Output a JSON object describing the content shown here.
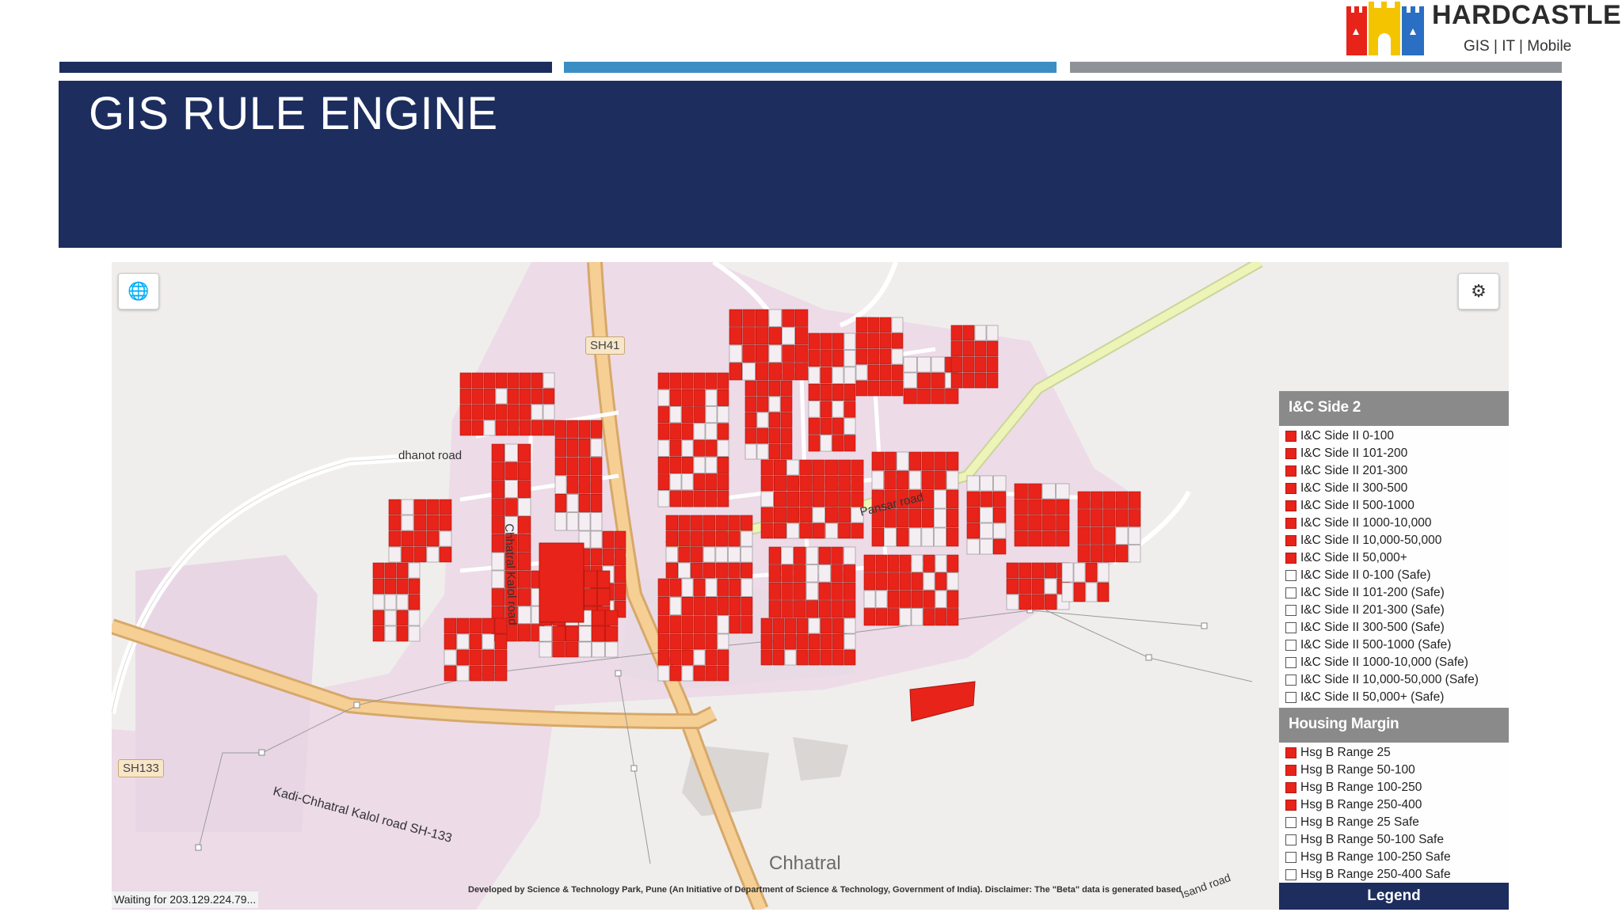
{
  "logo": {
    "title": "HARDCASTLE",
    "subtitle": "GIS | IT | Mobile",
    "colors": [
      "#e8231a",
      "#f5c400",
      "#2a6fc4"
    ]
  },
  "bars": {
    "colors": [
      "#1c2d5e",
      "#3b8ec4",
      "#8f9398"
    ]
  },
  "title_block": {
    "title": "GIS RULE ENGINE",
    "background": "#1c2d5e"
  },
  "map": {
    "controls": {
      "globe_icon": "globe-icon",
      "settings_icon": "gear-icon"
    },
    "labels": {
      "road_dhanot": "dhanot road",
      "road_pansar": "Pansar road",
      "road_chhatral": "Chhatral Kalol road",
      "road_kadi": "Kadi-Chhatral Kalol road SH-133",
      "road_isand": "Isand road",
      "shield_sh41": "SH41",
      "shield_sh133": "SH133",
      "town": "Chhatral"
    },
    "attribution": "Developed by Science & Technology Park, Pune (An Initiative of Department of Science & Technology, Government of India). Disclaimer: The \"Beta\" data is generated based",
    "status": "Waiting for 203.129.224.79...",
    "parcel_color": "#e8231a"
  },
  "legend": {
    "section1": {
      "title": "I&C Side 2",
      "items": [
        {
          "label": "I&C Side II 0-100",
          "checked": true
        },
        {
          "label": "I&C Side II 101-200",
          "checked": true
        },
        {
          "label": "I&C Side II 201-300",
          "checked": true
        },
        {
          "label": "I&C Side II 300-500",
          "checked": true
        },
        {
          "label": "I&C Side II 500-1000",
          "checked": true
        },
        {
          "label": "I&C Side II 1000-10,000",
          "checked": true
        },
        {
          "label": "I&C Side II 10,000-50,000",
          "checked": true
        },
        {
          "label": "I&C Side II 50,000+",
          "checked": true
        },
        {
          "label": "I&C Side II 0-100 (Safe)",
          "checked": false
        },
        {
          "label": "I&C Side II 101-200 (Safe)",
          "checked": false
        },
        {
          "label": "I&C Side II 201-300 (Safe)",
          "checked": false
        },
        {
          "label": "I&C Side II 300-500 (Safe)",
          "checked": false
        },
        {
          "label": "I&C Side II 500-1000 (Safe)",
          "checked": false
        },
        {
          "label": "I&C Side II 1000-10,000 (Safe)",
          "checked": false
        },
        {
          "label": "I&C Side II 10,000-50,000 (Safe)",
          "checked": false
        },
        {
          "label": "I&C Side II 50,000+ (Safe)",
          "checked": false
        }
      ]
    },
    "section2": {
      "title": "Housing Margin",
      "items": [
        {
          "label": "Hsg B Range 25",
          "checked": true
        },
        {
          "label": "Hsg B Range 50-100",
          "checked": true
        },
        {
          "label": "Hsg B Range 100-250",
          "checked": true
        },
        {
          "label": "Hsg B Range 250-400",
          "checked": true
        },
        {
          "label": "Hsg B Range 25 Safe",
          "checked": false
        },
        {
          "label": "Hsg B Range 50-100 Safe",
          "checked": false
        },
        {
          "label": "Hsg B Range 100-250 Safe",
          "checked": false
        },
        {
          "label": "Hsg B Range 250-400 Safe",
          "checked": false
        }
      ]
    },
    "footer": "Legend"
  }
}
